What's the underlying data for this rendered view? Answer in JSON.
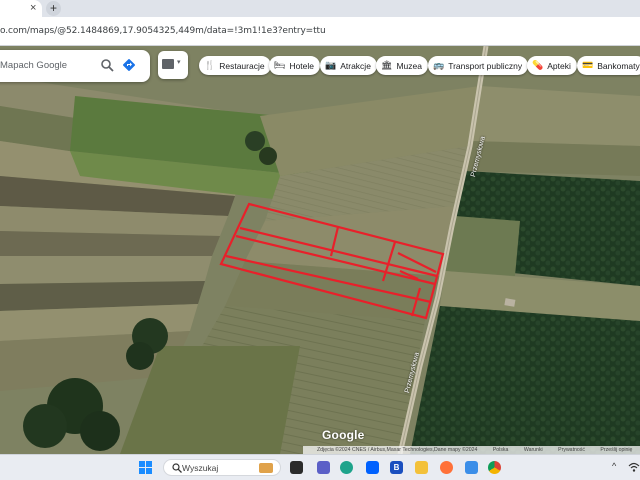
{
  "browser": {
    "tab_close": "×",
    "new_tab": "+",
    "url": "o.com/maps/@52.1484869,17.9054325,449m/data=!3m1!1e3?entry=ttu"
  },
  "map": {
    "search": {
      "placeholder": "Mapach Google",
      "icons": [
        "search-icon",
        "directions-icon"
      ]
    },
    "layers_icon": "keyboard-icon",
    "chips": [
      {
        "label": "Restauracje",
        "icon": "🍴"
      },
      {
        "label": "Hotele",
        "icon": "🛏"
      },
      {
        "label": "Atrakcje",
        "icon": "📷"
      },
      {
        "label": "Muzea",
        "icon": "🏛"
      },
      {
        "label": "Transport publiczny",
        "icon": "🚌"
      },
      {
        "label": "Apteki",
        "icon": "💊"
      },
      {
        "label": "Bankomaty",
        "icon": "💳"
      }
    ],
    "road_label_1": "Przemysłowa",
    "road_label_2": "Przemysłowa",
    "road_label_3": "Przemysłowa",
    "logo": "Google",
    "attribution": {
      "imagery": "Zdjęcia ©2024 CNES / Airbus,Maxar Technologies,Dane mapy ©2024",
      "country": "Polska",
      "terms": "Warunki",
      "privacy": "Prywatność",
      "feedback": "Prześlij opinię"
    },
    "plot_outline_color": "#e8202a"
  },
  "taskbar": {
    "search_placeholder": "Wyszukaj",
    "tray_caret": "^",
    "apps": [
      "file-explorer-icon",
      "task-view-icon",
      "teams-icon",
      "edge-icon",
      "dropbox-icon",
      "b-app-icon",
      "folder-icon",
      "firefox-icon",
      "chrome-icon"
    ]
  }
}
